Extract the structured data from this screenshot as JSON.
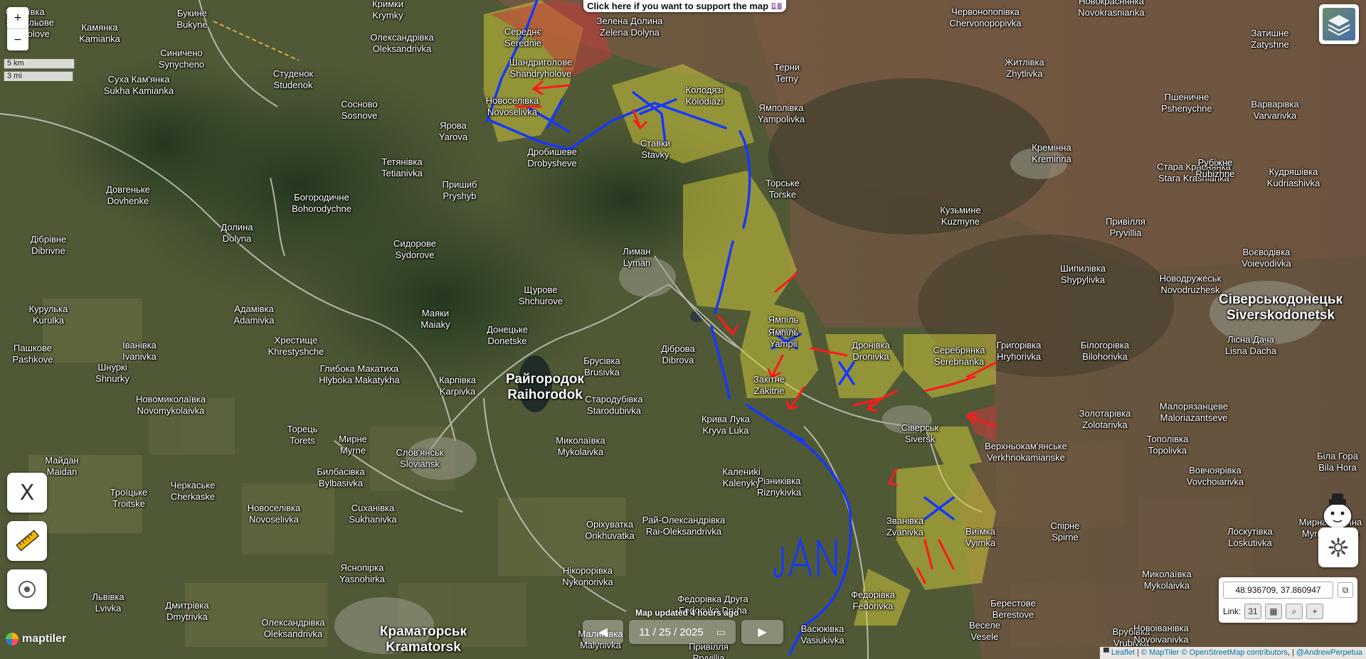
{
  "map": {
    "support_button": "Click here if you want to support the map 💷",
    "zoom_in": "+",
    "zoom_out": "−",
    "scale_km": "5 km",
    "scale_mi": "3 mi",
    "updated_text": "Map updated 4 hours ago",
    "date_value": "11 / 25 / 2025",
    "coordinates": "48.936709, 37.860947",
    "link_label": "Link:",
    "link_calendar_day": "31",
    "x_button": "X",
    "jan_annotation": "JAN",
    "brand": "maptiler",
    "attribution": {
      "leaflet": "Leaflet",
      "maptiler": "© MapTiler",
      "osm": "© OpenStreetMap contributors",
      "author": "@AndrewPerpetua"
    },
    "colors": {
      "russian_control": "#b83a3a",
      "contested": "#d8d23a",
      "ukr_lines": "#1a3cff",
      "attack_arrows": "#ff1a1a"
    }
  },
  "places": [
    {
      "uk": "Сергіївка",
      "en": "Serhiivka"
    },
    {
      "uk": "Польове",
      "en": "Polove"
    },
    {
      "uk": "Камянка",
      "en": "Kamianka"
    },
    {
      "uk": "Букине",
      "en": "Bukyne"
    },
    {
      "uk": "Кримки",
      "en": "Krymky"
    },
    {
      "uk": "Олександрівка",
      "en": "Oleksandrivka"
    },
    {
      "uk": "Середнє",
      "en": "Serednie"
    },
    {
      "uk": "Зелена Долина",
      "en": "Zelena Dolyna"
    },
    {
      "uk": "Червонопопівка",
      "en": "Chervonopopivka"
    },
    {
      "uk": "Новокраснянка",
      "en": "Novokrasnianka"
    },
    {
      "uk": "Затишне",
      "en": "Zatyshne"
    },
    {
      "uk": "Синичено",
      "en": "Synycheno"
    },
    {
      "uk": "Шандриголове",
      "en": "Shandryholove"
    },
    {
      "uk": "Студенок",
      "en": "Studenok"
    },
    {
      "uk": "Сухa Кам'янка",
      "en": "Sukha Kamianka"
    },
    {
      "uk": "Терни",
      "en": "Terny"
    },
    {
      "uk": "Колодязі",
      "en": "Kolodiazi"
    },
    {
      "uk": "Житлівка",
      "en": "Zhytlivka"
    },
    {
      "uk": "Новоселівка",
      "en": "Novoselivka"
    },
    {
      "uk": "Сосново",
      "en": "Sosnove"
    },
    {
      "uk": "Ямполівка",
      "en": "Yampolivka"
    },
    {
      "uk": "Пшеничне",
      "en": "Pshenychne"
    },
    {
      "uk": "Варварівка",
      "en": "Varvarivka"
    },
    {
      "uk": "Ярова",
      "en": "Yarova"
    },
    {
      "uk": "Ставки",
      "en": "Stavky"
    },
    {
      "uk": "Дробишеве",
      "en": "Drobysheve"
    },
    {
      "uk": "Кремінна",
      "en": "Kreminna"
    },
    {
      "uk": "Стара Краснянка",
      "en": "Stara Krasnianka"
    },
    {
      "uk": "Рубіжне",
      "en": "Rubizhne"
    },
    {
      "uk": "Кудряшівка",
      "en": "Kudriashivka"
    },
    {
      "uk": "Тетянівка",
      "en": "Tetianivka"
    },
    {
      "uk": "Торське",
      "en": "Torske"
    },
    {
      "uk": "Пришиб",
      "en": "Pryshyb"
    },
    {
      "uk": "Богородичне",
      "en": "Bohorodychne"
    },
    {
      "uk": "Довгеньке",
      "en": "Dovhenke"
    },
    {
      "uk": "Кузьмине",
      "en": "Kuzmyne"
    },
    {
      "uk": "Привілля",
      "en": "Pryvillia"
    },
    {
      "uk": "Дібрівне",
      "en": "Dibrivne"
    },
    {
      "uk": "Долина",
      "en": "Dolyna"
    },
    {
      "uk": "Сидорове",
      "en": "Sydorove"
    },
    {
      "uk": "Лиман",
      "en": "Lyman"
    },
    {
      "uk": "Воєводівка",
      "en": "Voievodivka"
    },
    {
      "uk": "Шипилівка",
      "en": "Shypylivka"
    },
    {
      "uk": "Новодружеськ",
      "en": "Novodruzhesk"
    },
    {
      "uk": "Сіверськодонецьк",
      "en": "Siverskodonetsk"
    },
    {
      "uk": "Щурове",
      "en": "Shchurove"
    },
    {
      "uk": "Адамівка",
      "en": "Adamivka"
    },
    {
      "uk": "Маяки",
      "en": "Maiaky"
    },
    {
      "uk": "Курулька",
      "en": "Kurulka"
    },
    {
      "uk": "Ямпіль",
      "en": "Yampil"
    },
    {
      "uk": "Донецьке",
      "en": "Donetske"
    },
    {
      "uk": "Лісна Дача",
      "en": "Lisna Dacha"
    },
    {
      "uk": "Пашкове",
      "en": "Pashkove"
    },
    {
      "uk": "Іванівка",
      "en": "Ivanivka"
    },
    {
      "uk": "Хрестище",
      "en": "Khrestyshche"
    },
    {
      "uk": "Брусівка",
      "en": "Brusivka"
    },
    {
      "uk": "Діброва",
      "en": "Dibrova"
    },
    {
      "uk": "Дронівка",
      "en": "Dronivka"
    },
    {
      "uk": "Серебрянка",
      "en": "Serebrianka"
    },
    {
      "uk": "Григорівка",
      "en": "Hryhorivka"
    },
    {
      "uk": "Білогорівка",
      "en": "Bilohorivka"
    },
    {
      "uk": "Шнуркі",
      "en": "Shnurky"
    },
    {
      "uk": "Глибока Макатиха",
      "en": "Hlyboka Makatykha"
    },
    {
      "uk": "Карпівка",
      "en": "Karpivka"
    },
    {
      "uk": "Райгородок",
      "en": "Raihorodok"
    },
    {
      "uk": "Закітне",
      "en": "Zakitne"
    },
    {
      "uk": "Новомиколаївка",
      "en": "Novomykolaivka"
    },
    {
      "uk": "Стародубівка",
      "en": "Starodubivka"
    },
    {
      "uk": "Золотарівка",
      "en": "Zolotarivka"
    },
    {
      "uk": "Малорязанцеве",
      "en": "Maloriazantseve"
    },
    {
      "uk": "Крива Лука",
      "en": "Kryva Luka"
    },
    {
      "uk": "Сіверськ",
      "en": "Siversk"
    },
    {
      "uk": "Торець",
      "en": "Torets"
    },
    {
      "uk": "Мирне",
      "en": "Myrne"
    },
    {
      "uk": "Слов'янськ",
      "en": "Sloviansk"
    },
    {
      "uk": "Миколаївка",
      "en": "Mykolaivka"
    },
    {
      "uk": "Верхньокам'янське",
      "en": "Verkhnokamianske"
    },
    {
      "uk": "Тополівка",
      "en": "Topolivka"
    },
    {
      "uk": "Майдан",
      "en": "Maidan"
    },
    {
      "uk": "Біла Гора",
      "en": "Bila Hora"
    },
    {
      "uk": "Калениki",
      "en": "Kalenyky"
    },
    {
      "uk": "Вовчоярівка",
      "en": "Vovchoiarivka"
    },
    {
      "uk": "Билбасівка",
      "en": "Bylbasivka"
    },
    {
      "uk": "Різниківка",
      "en": "Riznykivka"
    },
    {
      "uk": "Троїцьке",
      "en": "Troitske"
    },
    {
      "uk": "Черкаське",
      "en": "Cherkaske"
    },
    {
      "uk": "Новоселівка",
      "en": "Novoselivka"
    },
    {
      "uk": "Сuханівка",
      "en": "Sukhanivka"
    },
    {
      "uk": "Звaнівка",
      "en": "Zvanivka"
    },
    {
      "uk": "Спірне",
      "en": "Spirne"
    },
    {
      "uk": "Мирна Долина",
      "en": "Myrna Dolyna"
    },
    {
      "uk": "Оріхуватка",
      "en": "Orikhuvatka"
    },
    {
      "uk": "Рай-Олександрівка",
      "en": "Rai-Oleksandrivka"
    },
    {
      "uk": "Виїмка",
      "en": "Vyimka"
    },
    {
      "uk": "Лоскутівка",
      "en": "Loskutivka"
    },
    {
      "uk": "Яснопірка",
      "en": "Yasnohirka"
    },
    {
      "uk": "Нікopорівка",
      "en": "Nykonorivka"
    },
    {
      "uk": "Миколаївка",
      "en": "Mykolaivka"
    },
    {
      "uk": "Федорівка",
      "en": "Fedorivka"
    },
    {
      "uk": "Федорівка Друга",
      "en": "Fedorivka Druha"
    },
    {
      "uk": "Берестове",
      "en": "Berestove"
    },
    {
      "uk": "Львівка",
      "en": "Lvivka"
    },
    {
      "uk": "Дмитрівка",
      "en": "Dmytrivka"
    },
    {
      "uk": "Олександрівка",
      "en": "Oleksandrivka"
    },
    {
      "uk": "Краматорськ",
      "en": "Kramatorsk"
    },
    {
      "uk": "Малинівка",
      "en": "Malynivka"
    },
    {
      "uk": "Васюківка",
      "en": "Vasiukivka"
    },
    {
      "uk": "Веселе",
      "en": "Vesele"
    },
    {
      "uk": "Врубівка",
      "en": "Vrubivka"
    },
    {
      "uk": "Новоіванівка",
      "en": "Novoivanivka"
    },
    {
      "uk": "Привілля",
      "en": "Pryvillia"
    },
    {
      "uk": "Ямпіль",
      "en": "Yampil"
    }
  ]
}
